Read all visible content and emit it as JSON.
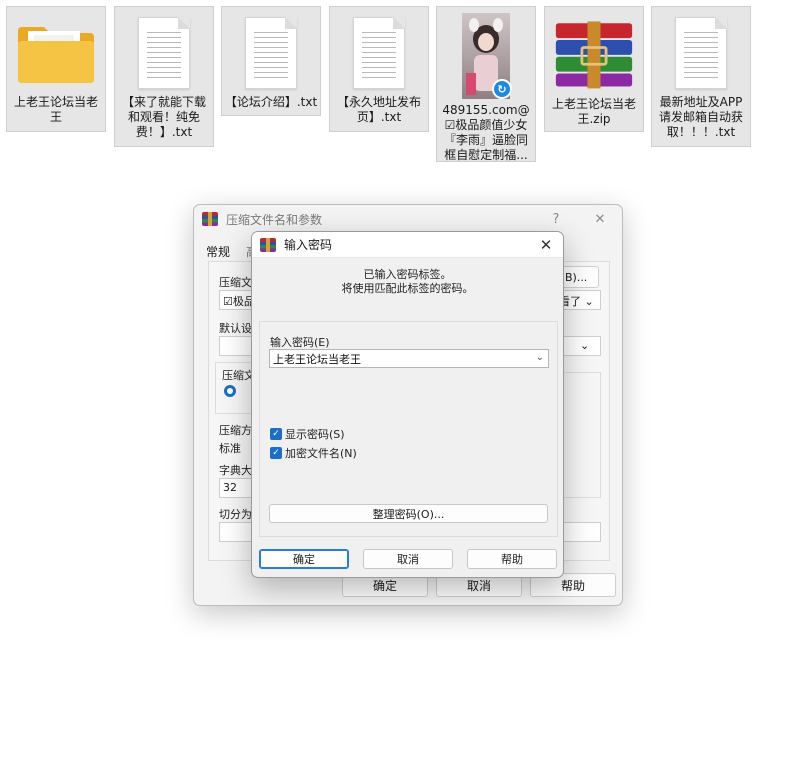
{
  "files": [
    {
      "name": "上老王论坛当老王",
      "type": "folder",
      "icon": "folder-icon"
    },
    {
      "name": "【来了就能下载和观看！纯免费！】.txt",
      "type": "txt",
      "icon": "text-file-icon"
    },
    {
      "name": "【论坛介绍】.txt",
      "type": "txt",
      "icon": "text-file-icon"
    },
    {
      "name": "【永久地址发布页】.txt",
      "type": "txt",
      "icon": "text-file-icon"
    },
    {
      "name": "489155.com@☑极品颜值少女『李雨』逼脸同框自慰定制福...",
      "type": "image",
      "icon": "image-thumbnail"
    },
    {
      "name": "上老王论坛当老王.zip",
      "type": "zip",
      "icon": "winrar-archive-icon"
    },
    {
      "name": "最新地址及APP请发邮箱自动获取！！！.txt",
      "type": "txt",
      "icon": "text-file-icon"
    }
  ],
  "archive_dialog": {
    "title": "压缩文件名和参数",
    "help_glyph": "?",
    "close_glyph": "✕",
    "tab_general": "常规",
    "tab_second_partial": "高",
    "label_archive_name": "压缩文件",
    "field_archive_name": "☑极品",
    "label_default": "默认设置",
    "label_format": "压缩文",
    "label_method": "压缩方",
    "field_method": "标准",
    "label_dict": "字典大小",
    "field_dict": "32",
    "label_split": "切分为分",
    "browse_button": "(B)...",
    "right_dropdown": "看了",
    "ok": "确定",
    "cancel": "取消",
    "help": "帮助"
  },
  "password_dialog": {
    "title": "输入密码",
    "close_glyph": "✕",
    "info_line1": "已输入密码标签。",
    "info_line2": "将使用匹配此标签的密码。",
    "password_label": "输入密码(E)",
    "password_value": "上老王论坛当老王",
    "show_password": "显示密码(S)",
    "show_password_checked": true,
    "encrypt_names": "加密文件名(N)",
    "encrypt_names_checked": true,
    "organize_button": "整理密码(O)...",
    "ok": "确定",
    "cancel": "取消",
    "help": "帮助"
  },
  "colors": {
    "accent": "#1b6fc7",
    "folder": "#f6c445",
    "tile_bg": "#e6e6e6"
  }
}
